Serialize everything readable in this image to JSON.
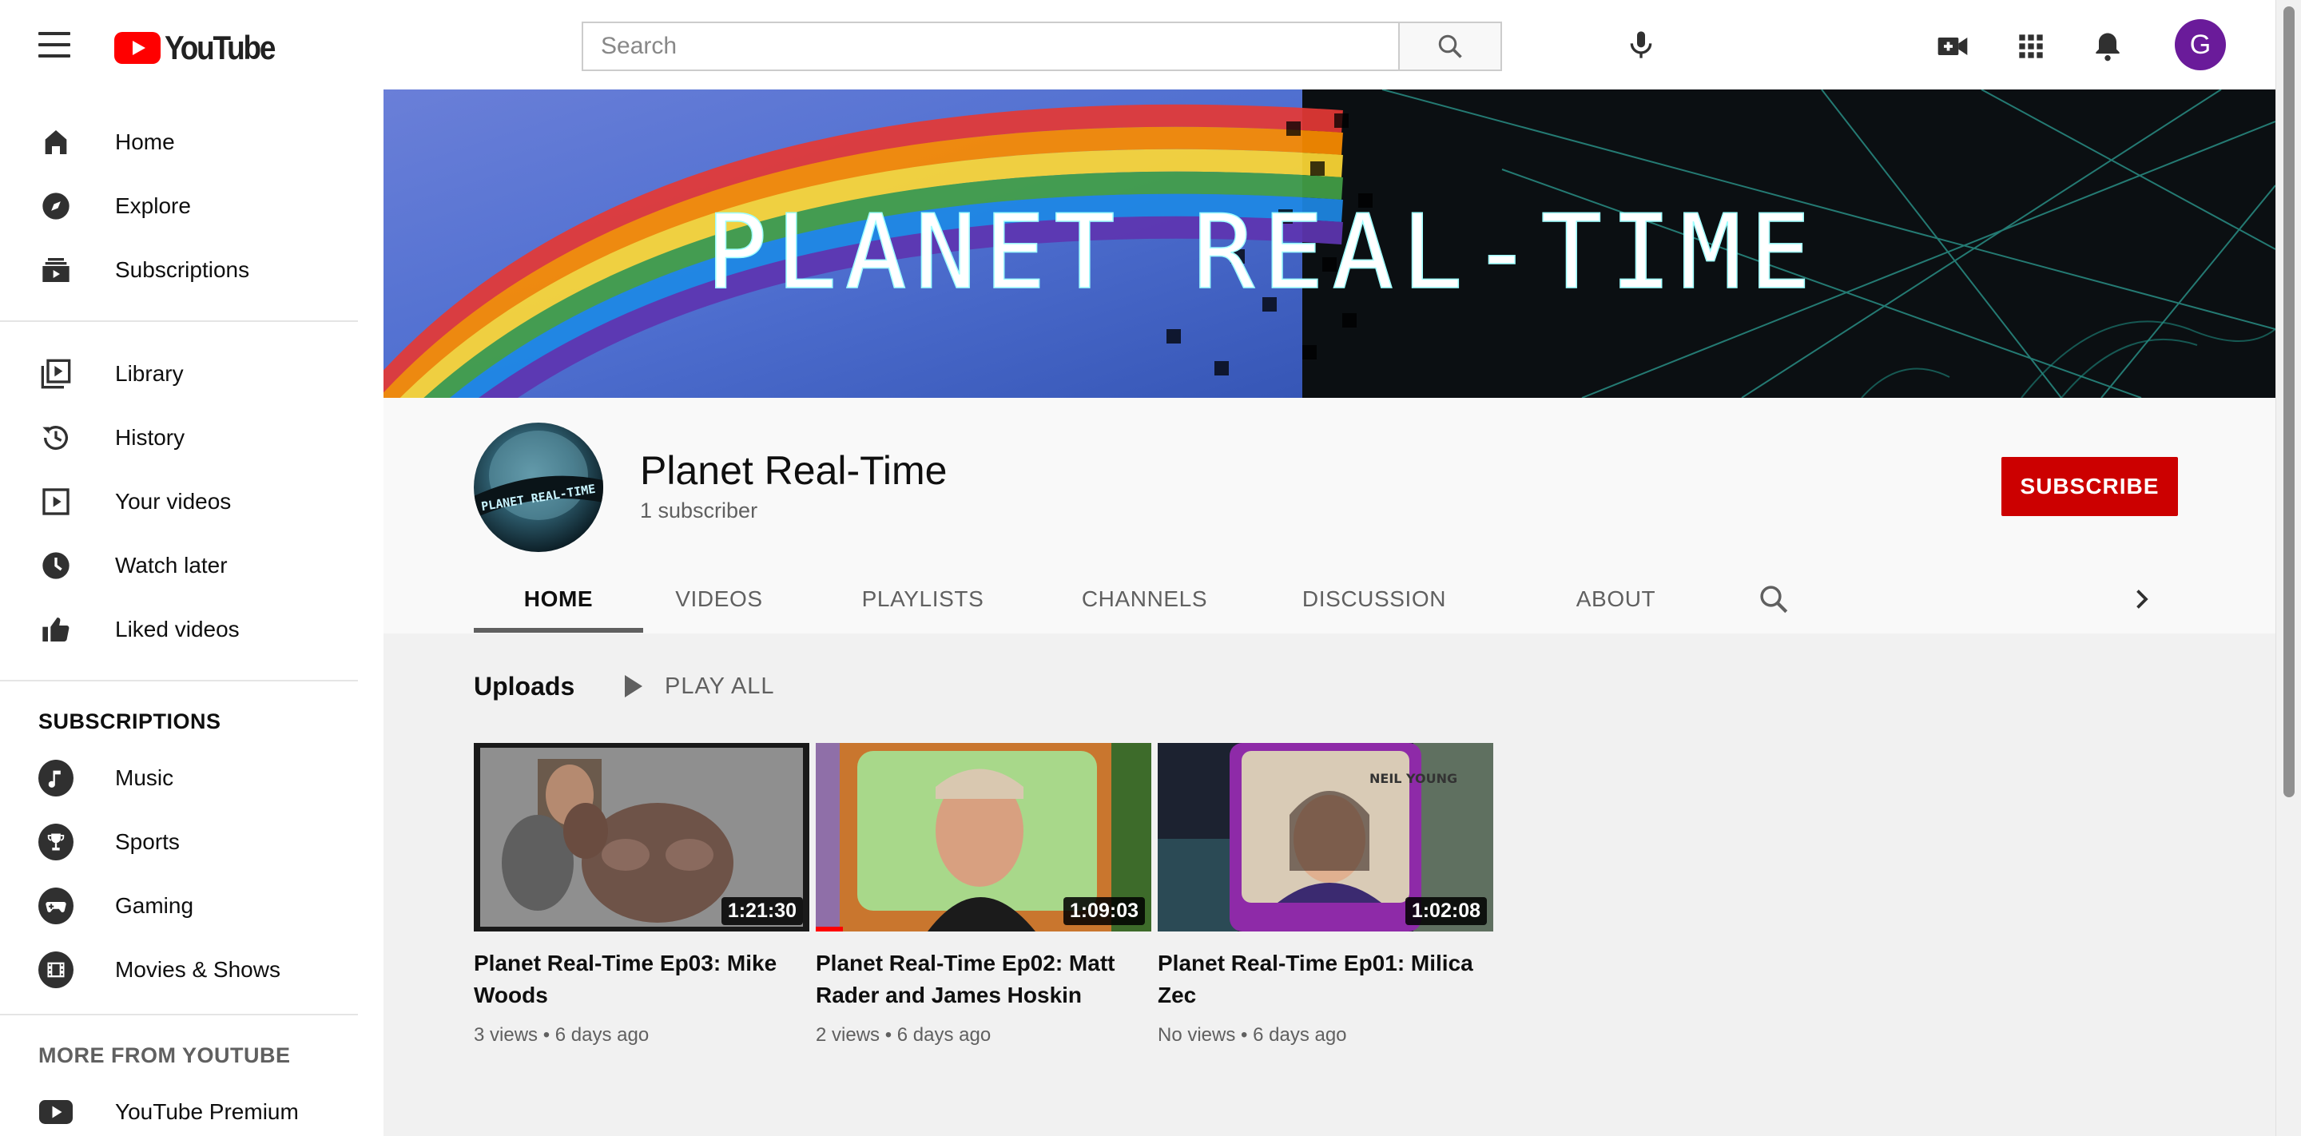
{
  "topbar": {
    "logo_text": "YouTube",
    "search_placeholder": "Search",
    "avatar_letter": "G"
  },
  "sidebar": {
    "main_items": [
      {
        "label": "Home",
        "icon": "home-icon"
      },
      {
        "label": "Explore",
        "icon": "compass-icon"
      },
      {
        "label": "Subscriptions",
        "icon": "subscriptions-icon"
      }
    ],
    "library_items": [
      {
        "label": "Library",
        "icon": "library-icon"
      },
      {
        "label": "History",
        "icon": "history-icon"
      },
      {
        "label": "Your videos",
        "icon": "your-videos-icon"
      },
      {
        "label": "Watch later",
        "icon": "clock-icon"
      },
      {
        "label": "Liked videos",
        "icon": "thumbs-up-icon"
      }
    ],
    "subscriptions_heading": "SUBSCRIPTIONS",
    "subscriptions": [
      {
        "label": "Music",
        "icon": "music-note-icon"
      },
      {
        "label": "Sports",
        "icon": "trophy-icon"
      },
      {
        "label": "Gaming",
        "icon": "gamepad-icon"
      },
      {
        "label": "Movies & Shows",
        "icon": "film-icon"
      }
    ],
    "more_heading": "MORE FROM YOUTUBE",
    "more_items": [
      {
        "label": "YouTube Premium",
        "icon": "youtube-icon"
      }
    ]
  },
  "banner": {
    "text": "PLANET REAL-TIME"
  },
  "channel": {
    "name": "Planet Real-Time",
    "subscribers": "1 subscriber",
    "subscribe_label": "SUBSCRIBE",
    "avatar_text": "PLANET REAL-TIME",
    "tabs": [
      "HOME",
      "VIDEOS",
      "PLAYLISTS",
      "CHANNELS",
      "DISCUSSION",
      "ABOUT"
    ],
    "active_tab": "HOME"
  },
  "uploads": {
    "title": "Uploads",
    "play_all": "PLAY ALL",
    "videos": [
      {
        "title": "Planet Real-Time Ep03: Mike Woods",
        "duration": "1:21:30",
        "views": "3 views",
        "age": "6 days ago"
      },
      {
        "title": "Planet Real-Time Ep02: Matt Rader and James Hoskin",
        "duration": "1:09:03",
        "views": "2 views",
        "age": "6 days ago",
        "progress": 0.08
      },
      {
        "title": "Planet Real-Time Ep01: Milica Zec",
        "duration": "1:02:08",
        "views": "No views",
        "age": "6 days ago"
      }
    ],
    "thumb3_sign": "NEIL YOUNG"
  },
  "colors": {
    "brand_red": "#ff0000",
    "subscribe_red": "#cc0000",
    "text_primary": "#0f0f0f",
    "text_secondary": "#606060"
  }
}
